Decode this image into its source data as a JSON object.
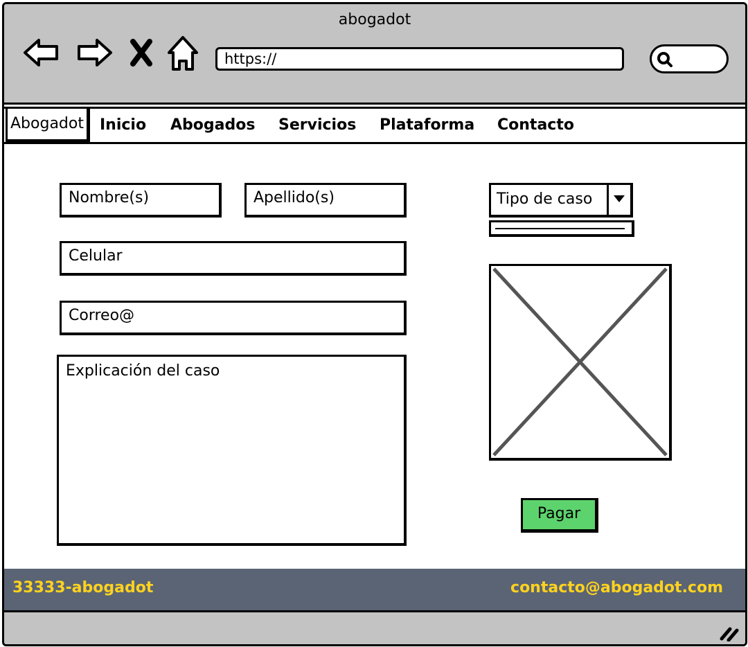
{
  "window": {
    "title": "abogadot"
  },
  "browser": {
    "url": "https://",
    "icons": [
      "back-arrow-icon",
      "forward-arrow-icon",
      "close-x-icon",
      "home-icon",
      "search-icon"
    ]
  },
  "menu": {
    "items": [
      {
        "label": "Abogadot",
        "active": true
      },
      {
        "label": "Inicio"
      },
      {
        "label": "Abogados"
      },
      {
        "label": "Servicios"
      },
      {
        "label": "Plataforma"
      },
      {
        "label": "Contacto"
      }
    ]
  },
  "form": {
    "nombre": "Nombre(s)",
    "apellido": "Apellido(s)",
    "celular": "Celular",
    "correo": "Correo@",
    "explicacion": "Explicación del caso",
    "tipo_caso": "Tipo de caso",
    "pay_label": "Pagar"
  },
  "footer": {
    "phone": "33333-abogadot",
    "email": "contacto@abogadot.com"
  },
  "colors": {
    "chrome": "#c3c3c3",
    "footer_bg": "#5a6474",
    "footer_text": "#ffd21f",
    "pay_button": "#5dd36d"
  }
}
